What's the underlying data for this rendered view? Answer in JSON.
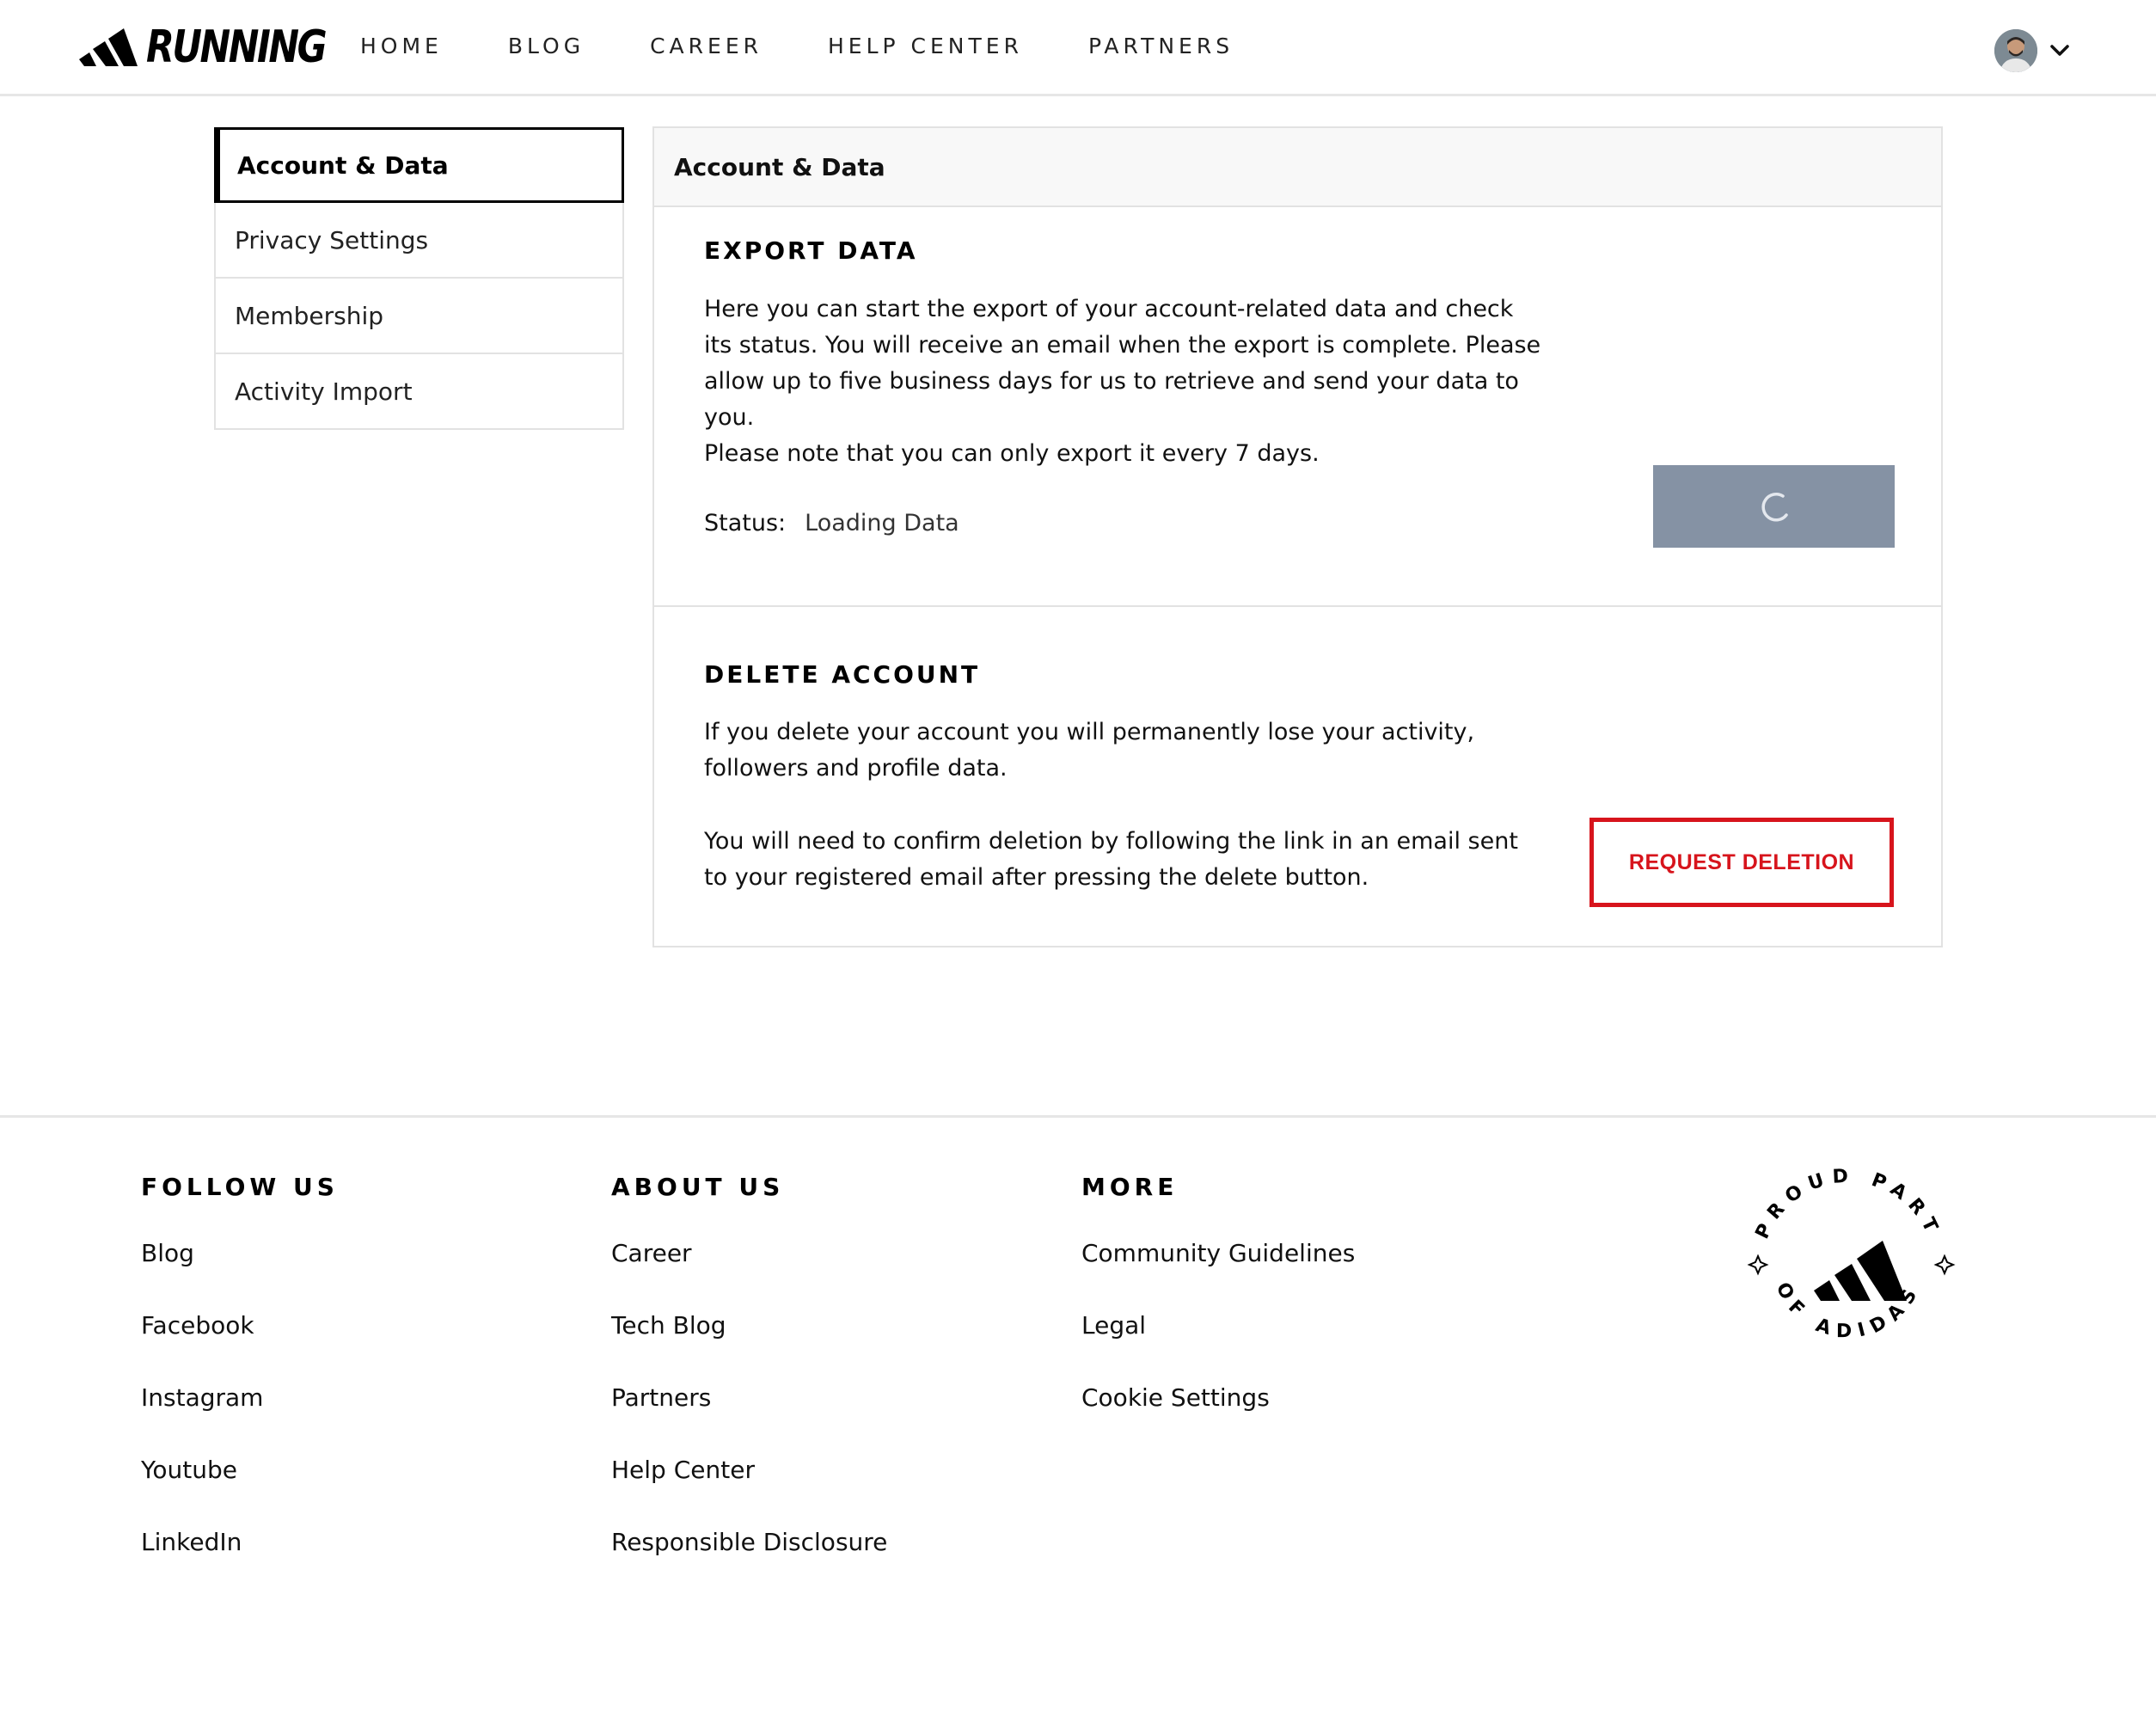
{
  "header": {
    "brand": "RUNNING",
    "nav": [
      "HOME",
      "BLOG",
      "CAREER",
      "HELP CENTER",
      "PARTNERS"
    ]
  },
  "sidebar": {
    "items": [
      {
        "label": "Account & Data",
        "active": true
      },
      {
        "label": "Privacy Settings",
        "active": false
      },
      {
        "label": "Membership",
        "active": false
      },
      {
        "label": "Activity Import",
        "active": false
      }
    ]
  },
  "panel": {
    "title": "Account & Data",
    "export": {
      "heading": "EXPORT DATA",
      "description": "Here you can start the export of your account-related data and check its status. You will receive an email when the export is complete. Please allow up to five business days for us to retrieve and send your data to you.",
      "note": "Please note that you can only export it every 7 days.",
      "status_label": "Status:",
      "status_value": "Loading Data",
      "button_color": "#8592a4"
    },
    "delete": {
      "heading": "DELETE ACCOUNT",
      "description": "If you delete your account you will permanently lose your activity, followers and profile data.",
      "note": "You will need to confirm deletion by following the link in an email sent to your registered email after pressing the delete button.",
      "button_label": "REQUEST DELETION",
      "button_color": "#d7141c"
    }
  },
  "footer": {
    "columns": [
      {
        "title": "FOLLOW US",
        "links": [
          "Blog",
          "Facebook",
          "Instagram",
          "Youtube",
          "LinkedIn"
        ]
      },
      {
        "title": "ABOUT US",
        "links": [
          "Career",
          "Tech Blog",
          "Partners",
          "Help Center",
          "Responsible Disclosure"
        ]
      },
      {
        "title": "MORE",
        "links": [
          "Community Guidelines",
          "Legal",
          "Cookie Settings"
        ]
      }
    ],
    "badge_text_top": "PROUD PART",
    "badge_text_bottom": "OF ADIDAS"
  }
}
